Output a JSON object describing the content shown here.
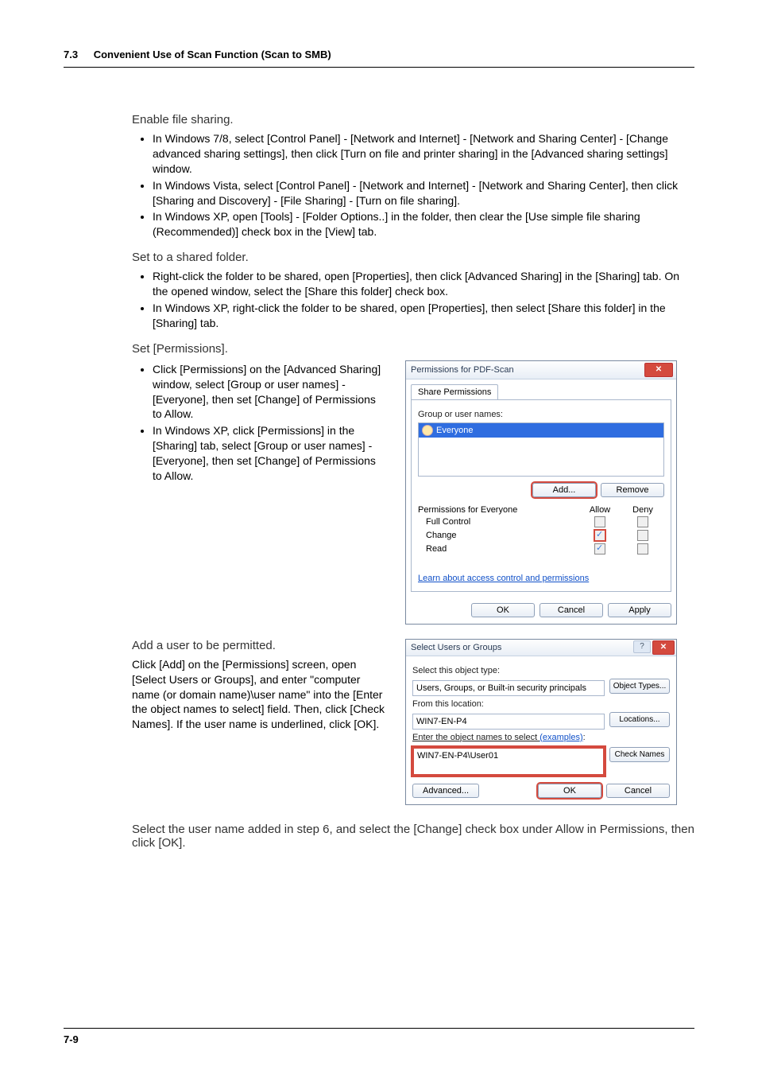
{
  "header": {
    "num": "7.3",
    "title": "Convenient Use of Scan Function (Scan to SMB)"
  },
  "footer": "7-9",
  "step1": {
    "title": "Enable file sharing.",
    "bullets": [
      "In Windows 7/8, select [Control Panel] - [Network and Internet] - [Network and Sharing Center] - [Change advanced sharing settings], then click [Turn on file and printer sharing] in the [Advanced sharing settings] window.",
      "In Windows Vista, select [Control Panel] - [Network and Internet] - [Network and Sharing Center], then click [Sharing and Discovery] - [File Sharing] - [Turn on file sharing].",
      "In Windows XP, open [Tools] - [Folder Options..] in the folder, then clear the [Use simple file sharing (Recommended)] check box in the [View] tab."
    ]
  },
  "step2": {
    "title": "Set to a shared folder.",
    "bullets": [
      "Right-click the folder to be shared, open [Properties], then click [Advanced Sharing] in the [Sharing] tab. On the opened window, select the [Share this folder] check box.",
      "In Windows XP, right-click the folder to be shared, open [Properties], then select [Share this folder] in the [Sharing] tab."
    ]
  },
  "step3": {
    "title": "Set [Permissions].",
    "bullets": [
      "Click [Permissions] on the [Advanced Sharing] window, select [Group or user names] - [Everyone], then set [Change] of Permissions to Allow.",
      "In Windows XP, click [Permissions] in the [Sharing] tab, select [Group or user names] - [Everyone], then set [Change] of Permissions to Allow."
    ]
  },
  "step4": {
    "title": "Add a user to be permitted.",
    "para": "Click [Add] on the [Permissions] screen, open [Select Users or Groups], and enter \"computer name (or domain name)\\user name\" into the [Enter the object names to select] field. Then, click [Check Names]. If the user name is underlined, click [OK]."
  },
  "step5": {
    "para": "Select the user name added in step 6, and select the [Change] check box under Allow in Permissions, then click [OK]."
  },
  "dlg1": {
    "title": "Permissions for PDF-Scan",
    "tab": "Share Permissions",
    "groupLabel": "Group or user names:",
    "selected": "Everyone",
    "add": "Add...",
    "remove": "Remove",
    "permFor": "Permissions for Everyone",
    "allow": "Allow",
    "deny": "Deny",
    "rows": [
      {
        "name": "Full Control",
        "allow": false,
        "deny": false,
        "hi": false
      },
      {
        "name": "Change",
        "allow": true,
        "deny": false,
        "hi": true
      },
      {
        "name": "Read",
        "allow": true,
        "deny": false,
        "hi": false
      }
    ],
    "learn": "Learn about access control and permissions",
    "ok": "OK",
    "cancel": "Cancel",
    "apply": "Apply"
  },
  "dlg2": {
    "title": "Select Users or Groups",
    "selObjType": "Select this object type:",
    "objType": "Users, Groups, or Built-in security principals",
    "objTypesBtn": "Object Types...",
    "fromLoc": "From this location:",
    "loc": "WIN7-EN-P4",
    "locBtn": "Locations...",
    "enterLabelA": "Enter the object names to select ",
    "enterLabelB": "(examples)",
    "enterLabelC": ":",
    "enterVal": "WIN7-EN-P4\\User01",
    "checkNames": "Check Names",
    "advanced": "Advanced...",
    "ok": "OK",
    "cancel": "Cancel"
  }
}
